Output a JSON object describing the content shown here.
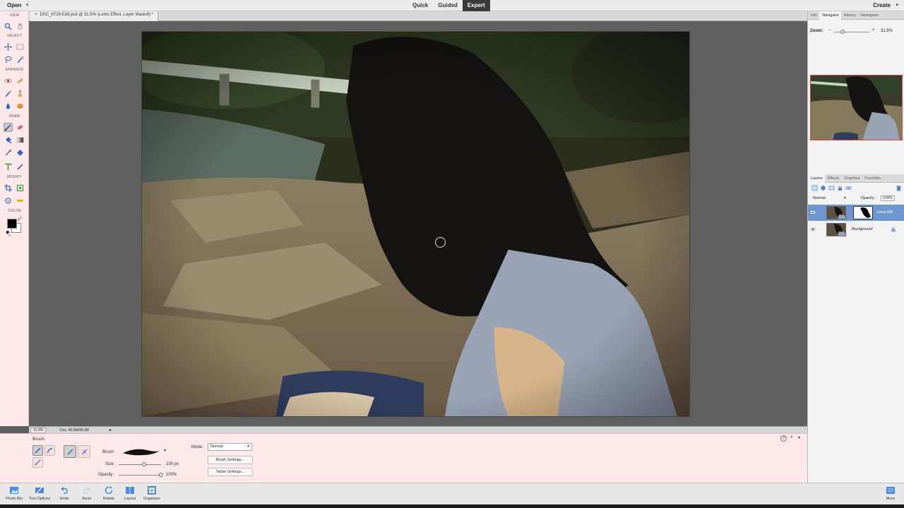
{
  "menubar": {
    "open_label": "Open",
    "open_arrow": "▾",
    "modes": [
      "Quick",
      "Guided",
      "Expert"
    ],
    "active_mode": "Expert",
    "create_label": "Create",
    "create_arrow": "▾"
  },
  "document": {
    "tab_close": "×",
    "tab_title": "DSC_6729-Edit.psd @ 31.5% (Lomo Effect, Layer Mask/8) *"
  },
  "toolbox": {
    "sections": [
      "VIEW",
      "SELECT",
      "ENHANCE",
      "DRAW",
      "MODIFY",
      "COLOR"
    ],
    "icons": [
      "zoom-icon",
      "hand-icon",
      "move-icon",
      "marquee-icon",
      "lasso-icon",
      "quick-selection-icon",
      "red-eye-icon",
      "spot-healing-icon",
      "smart-brush-icon",
      "clone-stamp-icon",
      "blur-icon",
      "sponge-icon",
      "brush-icon",
      "eraser-icon",
      "paint-bucket-icon",
      "gradient-icon",
      "eyedropper-icon",
      "shape-icon",
      "type-icon",
      "pencil-icon",
      "crop-icon",
      "recompose-icon",
      "content-aware-move-icon",
      "straighten-icon"
    ],
    "foreground_color": "#000000",
    "background_color": "#ffffff"
  },
  "statusbar": {
    "zoom": "31.5%",
    "doc_info": "Doc: 46.0M/96.5M",
    "arrow": "▸"
  },
  "panels": {
    "top_tabs": [
      "Info",
      "Navigator",
      "History",
      "Histogram"
    ],
    "top_active": "Navigator",
    "zoom_label": "Zoom:",
    "zoom_minus": "−",
    "zoom_plus": "+",
    "zoom_value": "31.5%",
    "zoom_level": 0.24,
    "layer_tabs": [
      "Layers",
      "Effects",
      "Graphics",
      "Favorites"
    ],
    "layer_active": "Layers",
    "blend_mode": "Normal",
    "blend_arrow": "▾",
    "opacity_label": "Opacity:",
    "opacity_value": "100%",
    "layers": [
      {
        "name": "Lomo Eff...",
        "selected": true
      },
      {
        "name": "Background",
        "selected": false
      }
    ]
  },
  "tool_options": {
    "title": "Brush",
    "brush_label": "Brush:",
    "brush_arrow": "▾",
    "size_label": "Size:",
    "size_value": "100 px",
    "size_level": 0.6,
    "opacity_label": "Opacity:",
    "opacity_value": "100%",
    "opacity_level": 1.0,
    "mode_label": "Mode:",
    "mode_value": "Normal",
    "mode_arrow": "▾",
    "brush_settings_button": "Brush Settings...",
    "tablet_settings_button": "Tablet Settings...",
    "help_icon": "?",
    "menu_icon": "≡",
    "collapse_icon": "▾"
  },
  "taskbar": {
    "left_items": [
      {
        "label": "Photo Bin",
        "icon": "photo-bin-icon"
      },
      {
        "label": "Tool Options",
        "icon": "tool-options-icon"
      },
      {
        "label": "Undo",
        "icon": "undo-icon"
      },
      {
        "label": "Redo",
        "icon": "redo-icon"
      },
      {
        "label": "Rotate",
        "icon": "rotate-icon"
      },
      {
        "label": "Layout",
        "icon": "layout-icon"
      },
      {
        "label": "Organizer",
        "icon": "organizer-icon"
      }
    ],
    "more_label": "More"
  },
  "colors": {
    "active_mode_bg": "#3a3a3a",
    "panel_pink": "#fde8ea",
    "layer_selected": "#6d96d0",
    "navigator_frame": "#e0434d"
  }
}
